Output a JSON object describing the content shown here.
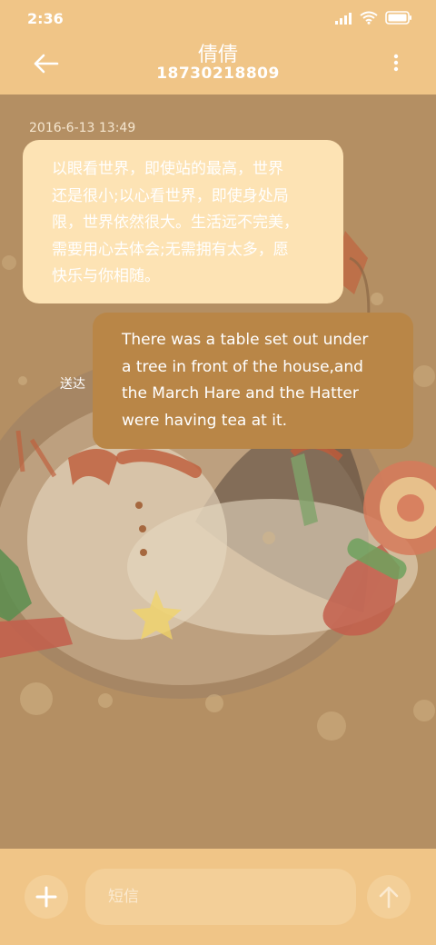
{
  "status_bar": {
    "time": "2:36"
  },
  "header": {
    "contact_name": "倩倩",
    "phone_number": "18730218809"
  },
  "messages": [
    {
      "timestamp": "2016-6-13 13:49",
      "direction": "incoming",
      "lines": [
        "以眼看世界，即使站的最高，世界",
        "还是很小;以心看世界，即使身处局",
        "限，世界依然很大。生活远不完美，",
        "需要用心去体会;无需拥有太多，愿",
        "快乐与你相随。"
      ]
    },
    {
      "direction": "outgoing",
      "status": "送达",
      "lines": [
        "There was a table set out under",
        "a tree in front of the house,and",
        "the March Hare and the Hatter",
        "were having tea at it."
      ]
    }
  ],
  "compose": {
    "placeholder": "短信"
  },
  "icons": {
    "back": "arrow-left-icon",
    "more": "more-vertical-icon",
    "add": "plus-icon",
    "send": "arrow-up-icon",
    "signal": "signal-icon",
    "wifi": "wifi-icon",
    "battery": "battery-icon"
  },
  "colors": {
    "bar": "#f0c587",
    "wallpaper": "#b48f63",
    "incoming_bubble": "#fde3b4",
    "outgoing_bubble": "#b98647",
    "text": "#ffffff"
  }
}
